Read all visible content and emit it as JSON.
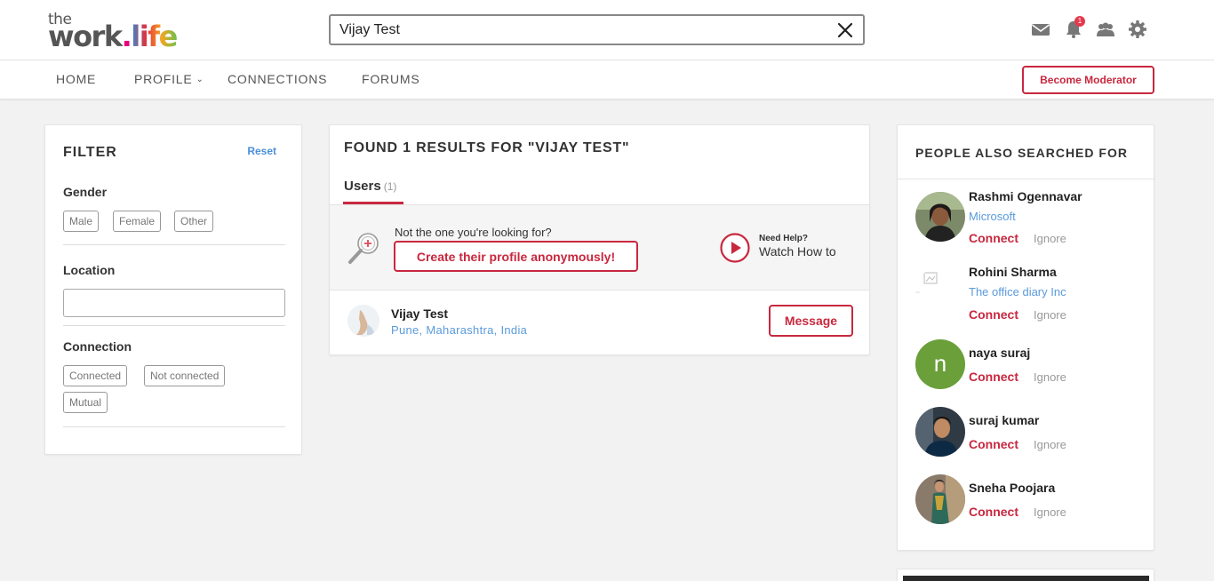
{
  "header": {
    "logo_top": "the",
    "logo_word": "work",
    "logo_dot": ".",
    "logo_life": "life",
    "search_value": "Vijay Test",
    "notification_count": "1"
  },
  "nav": {
    "home": "HOME",
    "profile": "PROFILE",
    "connections": "CONNECTIONS",
    "forums": "FORUMS",
    "become_moderator": "Become Moderator"
  },
  "filter": {
    "title": "FILTER",
    "reset": "Reset",
    "gender_label": "Gender",
    "gender_options": [
      "Male",
      "Female",
      "Other"
    ],
    "location_label": "Location",
    "location_value": "",
    "connection_label": "Connection",
    "connection_options": [
      "Connected",
      "Not connected",
      "Mutual"
    ]
  },
  "results": {
    "heading": "FOUND 1 RESULTS FOR \"VIJAY TEST\"",
    "tab_users": "Users",
    "tab_users_count": "(1)",
    "not_the_one": "Not the one you're looking for?",
    "create_profile": "Create their profile anonymously!",
    "need_help": "Need Help?",
    "watch_how": "Watch How to",
    "user": {
      "name": "Vijay Test",
      "location": "Pune, Maharashtra, India",
      "message_button": "Message"
    }
  },
  "people_also": {
    "title": "PEOPLE ALSO SEARCHED FOR",
    "connect_label": "Connect",
    "ignore_label": "Ignore",
    "people": [
      {
        "name": "Rashmi Ogennavar",
        "company": "Microsoft"
      },
      {
        "name": "Rohini Sharma",
        "company": "The office diary Inc"
      },
      {
        "name": "naya suraj",
        "company": "",
        "initial": "n"
      },
      {
        "name": "suraj kumar",
        "company": ""
      },
      {
        "name": "Sneha Poojara",
        "company": ""
      }
    ]
  },
  "colors": {
    "accent": "#c8283f",
    "link": "#5a9bdc",
    "initial_avatar": "#6a9f3a"
  },
  "icons": [
    "close-icon",
    "mail-icon",
    "bell-icon",
    "group-icon",
    "gear-icon",
    "chevron-down-icon",
    "magnifier-icon",
    "play-icon"
  ]
}
